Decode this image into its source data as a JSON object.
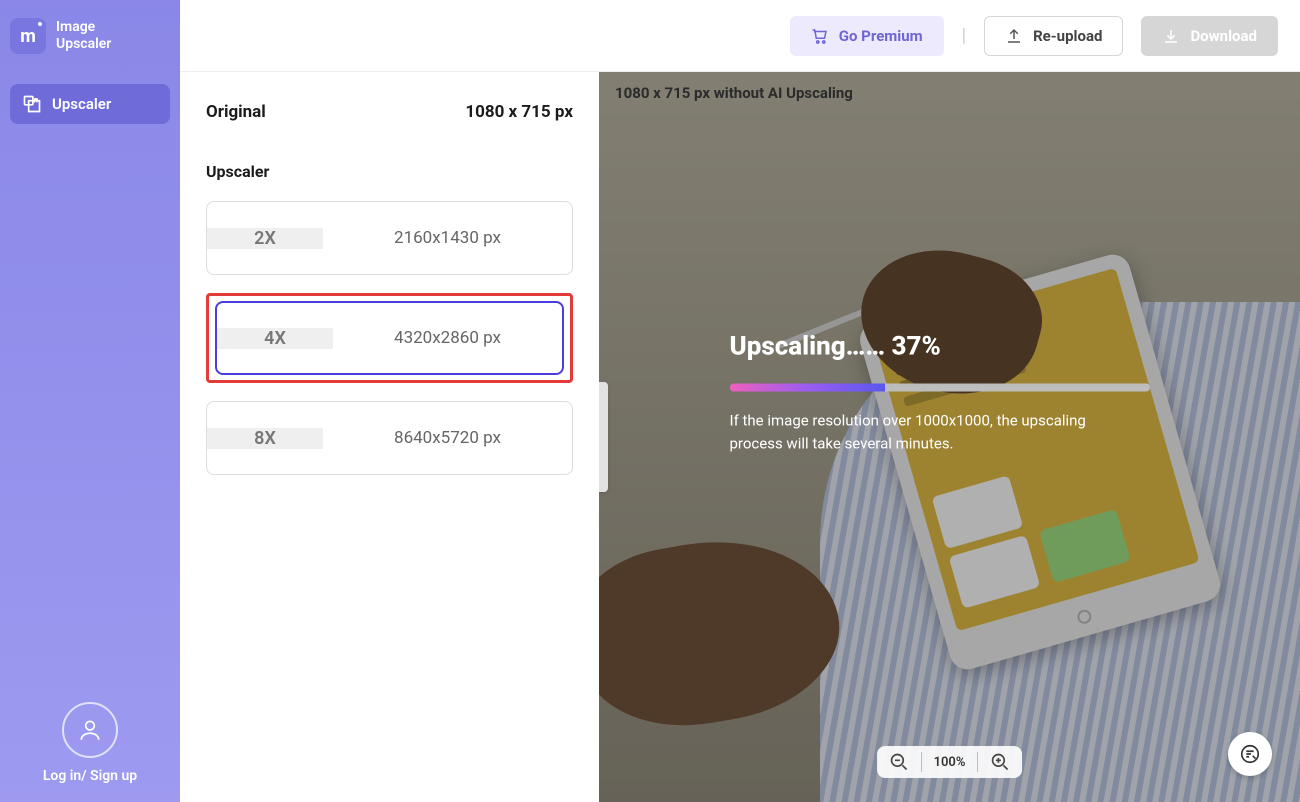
{
  "brand": {
    "name": "Image\nUpscaler",
    "logo_letter": "m"
  },
  "nav": {
    "items": [
      {
        "label": "Upscaler"
      }
    ]
  },
  "auth": {
    "login_label": "Log in/ Sign up"
  },
  "topbar": {
    "premium_label": "Go Premium",
    "reupload_label": "Re-upload",
    "download_label": "Download"
  },
  "options": {
    "original_label": "Original",
    "original_dim": "1080 x 715 px",
    "section_title": "Upscaler",
    "scales": [
      {
        "factor": "2X",
        "dim": "2160x1430 px"
      },
      {
        "factor": "4X",
        "dim": "4320x2860 px"
      },
      {
        "factor": "8X",
        "dim": "8640x5720 px"
      }
    ]
  },
  "preview": {
    "dim_label": "1080 x 715 px without AI Upscaling",
    "progress_title": "Upscaling…… 37%",
    "progress_percent": 37,
    "progress_note": "If the image resolution over 1000x1000, the upscaling process will take several minutes.",
    "zoom_value": "100%"
  },
  "colors": {
    "accent": "#6f65d3",
    "highlight": "#e33a3a"
  }
}
